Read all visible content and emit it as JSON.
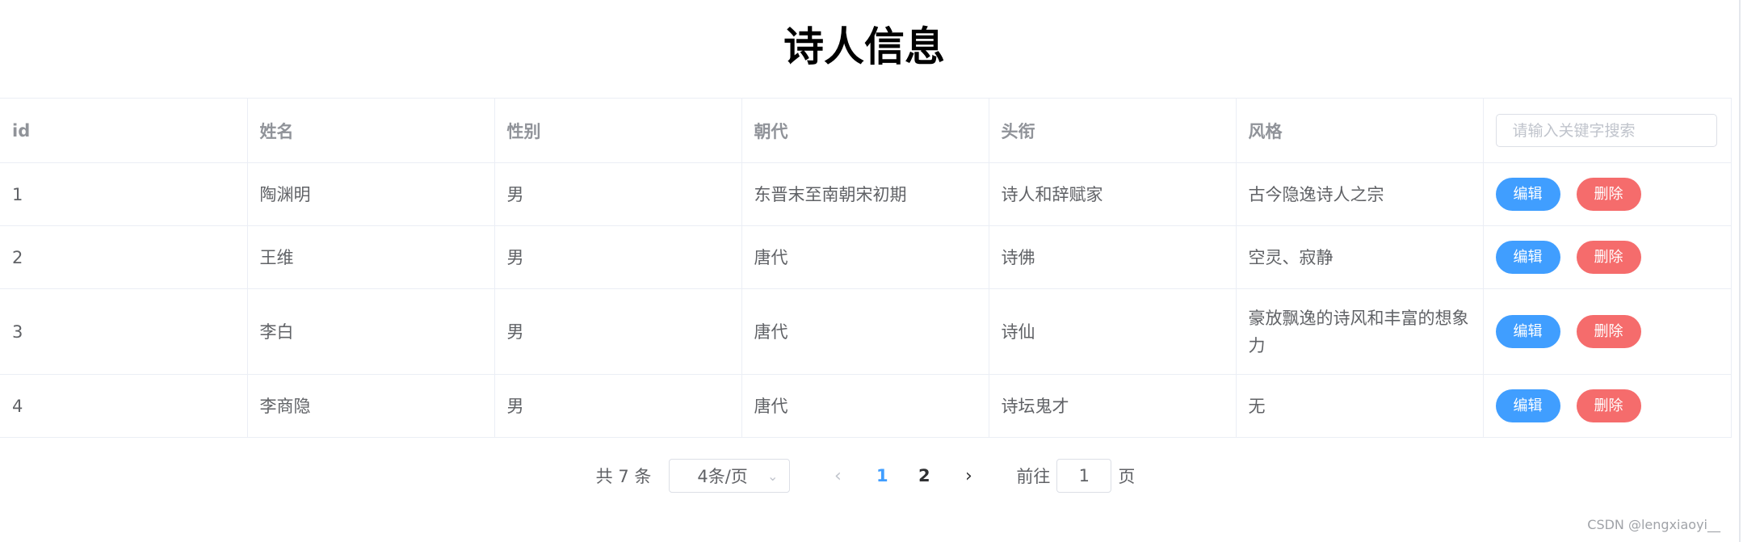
{
  "page": {
    "title": "诗人信息"
  },
  "table": {
    "columns": [
      "id",
      "姓名",
      "性别",
      "朝代",
      "头衔",
      "风格"
    ],
    "search_placeholder": "请输入关键字搜索",
    "rows": [
      {
        "id": "1",
        "name": "陶渊明",
        "gender": "男",
        "dynasty": "东晋末至南朝宋初期",
        "title": "诗人和辞赋家",
        "style": "古今隐逸诗人之宗"
      },
      {
        "id": "2",
        "name": "王维",
        "gender": "男",
        "dynasty": "唐代",
        "title": "诗佛",
        "style": "空灵、寂静"
      },
      {
        "id": "3",
        "name": "李白",
        "gender": "男",
        "dynasty": "唐代",
        "title": "诗仙",
        "style": "豪放飘逸的诗风和丰富的想象力"
      },
      {
        "id": "4",
        "name": "李商隐",
        "gender": "男",
        "dynasty": "唐代",
        "title": "诗坛鬼才",
        "style": "无"
      }
    ],
    "edit_label": "编辑",
    "delete_label": "删除"
  },
  "pagination": {
    "total_text": "共 7 条",
    "page_size": "4条/页",
    "pages": [
      "1",
      "2"
    ],
    "current_page": "1",
    "goto_prefix": "前往",
    "goto_value": "1",
    "goto_suffix": "页"
  },
  "icons": {
    "prev": "chevron-left-icon",
    "next": "chevron-right-icon",
    "select_arrow": "chevron-down-icon"
  },
  "colors": {
    "primary": "#409eff",
    "danger": "#f56c6c",
    "header_text": "#909399",
    "body_text": "#606266",
    "border": "#ebeef5"
  },
  "watermark": "CSDN @lengxiaoyi__"
}
